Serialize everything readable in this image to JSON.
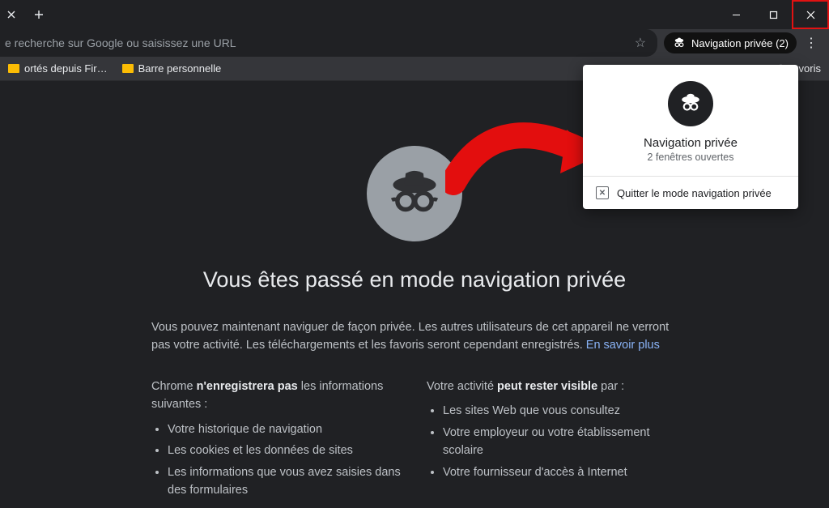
{
  "omnibox": {
    "placeholder": "e recherche sur Google ou saisissez une URL"
  },
  "incognito_chip": {
    "label": "Navigation privée (2)"
  },
  "bookmarks": {
    "item1": "ortés depuis Fir…",
    "item2": "Barre personnelle",
    "overflow": "ovoris"
  },
  "content": {
    "title": "Vous êtes passé en mode navigation privée",
    "lead1": "Vous pouvez maintenant naviguer de façon privée. Les autres utilisateurs de cet appareil ne verront pas votre activité. Les téléchargements et les favoris seront cependant enregistrés. ",
    "lead_link": "En savoir plus",
    "col1_before": "Chrome ",
    "col1_bold": "n'enregistrera pas",
    "col1_after": " les informations suivantes :",
    "col1_items": {
      "0": "Votre historique de navigation",
      "1": "Les cookies et les données de sites",
      "2": "Les informations que vous avez saisies dans des formulaires"
    },
    "col2_before": "Votre activité ",
    "col2_bold": "peut rester visible",
    "col2_after": " par :",
    "col2_items": {
      "0": "Les sites Web que vous consultez",
      "1": "Votre employeur ou votre établissement scolaire",
      "2": "Votre fournisseur d'accès à Internet"
    }
  },
  "popup": {
    "title": "Navigation privée",
    "subtitle": "2 fenêtres ouvertes",
    "action": "Quitter le mode navigation privée"
  }
}
